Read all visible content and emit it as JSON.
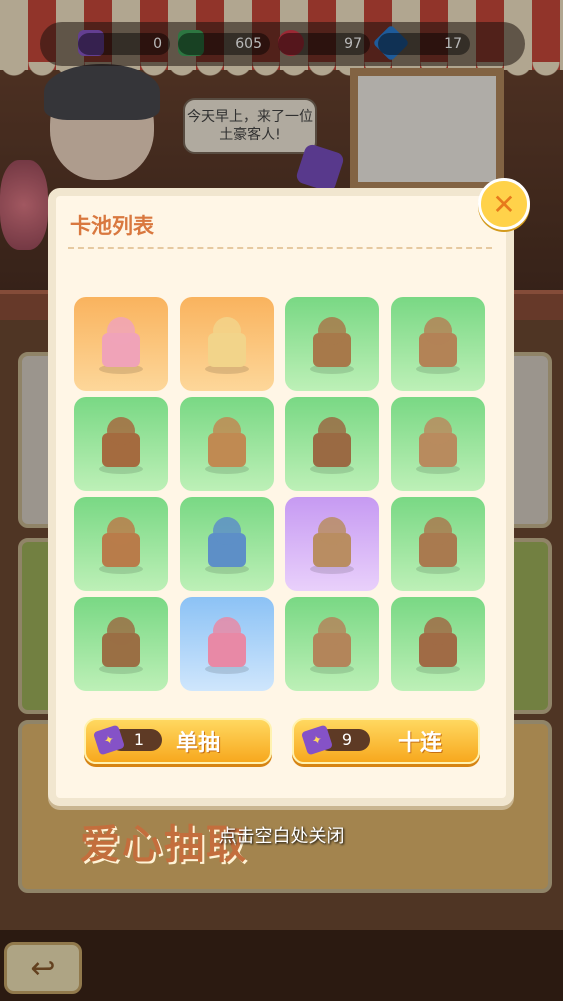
{
  "currency": [
    {
      "name": "ticket",
      "value": "0",
      "icon": "ticket-plus-icon",
      "color": "#8a57c9"
    },
    {
      "name": "cash",
      "value": "605",
      "icon": "cash-plus-icon",
      "color": "#3fa45a"
    },
    {
      "name": "heart",
      "value": "97",
      "icon": "heart-plus-icon",
      "color": "#d8394a"
    },
    {
      "name": "diamond",
      "value": "17",
      "icon": "diamond-plus-icon",
      "color": "#2a7fd6"
    }
  ],
  "npc": {
    "speech": "今天早上，来了一位土豪客人!"
  },
  "dialog": {
    "title": "卡池列表",
    "close_icon": "✕",
    "items": [
      {
        "icon": "pink-cherry-tree-icon",
        "bg": "orange"
      },
      {
        "icon": "golden-tree-icon",
        "bg": "orange"
      },
      {
        "icon": "wooden-washstand-icon",
        "bg": "green"
      },
      {
        "icon": "wooden-bathtub-icon",
        "bg": "green"
      },
      {
        "icon": "wooden-toilet-icon",
        "bg": "green"
      },
      {
        "icon": "bedside-table-lamp-icon",
        "bg": "green"
      },
      {
        "icon": "vanity-mirror-icon",
        "bg": "green"
      },
      {
        "icon": "wooden-bed-icon",
        "bg": "green"
      },
      {
        "icon": "wooden-wardrobe-icon",
        "bg": "green"
      },
      {
        "icon": "blue-suitcase-icon",
        "bg": "green"
      },
      {
        "icon": "rocking-chair-icon",
        "bg": "purple"
      },
      {
        "icon": "wooden-sofa-bed-icon",
        "bg": "green"
      },
      {
        "icon": "flower-fence-icon",
        "bg": "green"
      },
      {
        "icon": "pink-flower-pot-icon",
        "bg": "blue"
      },
      {
        "icon": "round-flower-table-icon",
        "bg": "green"
      },
      {
        "icon": "flower-armchair-icon",
        "bg": "green"
      }
    ],
    "single_pull": {
      "count": "1",
      "label": "单抽"
    },
    "ten_pull": {
      "count": "9",
      "label": "十连"
    }
  },
  "background": {
    "banner": "爱心抽取"
  },
  "close_hint": "点击空白处关闭",
  "colors": {
    "accent": "#d9783f",
    "button": "#f7a81e"
  }
}
